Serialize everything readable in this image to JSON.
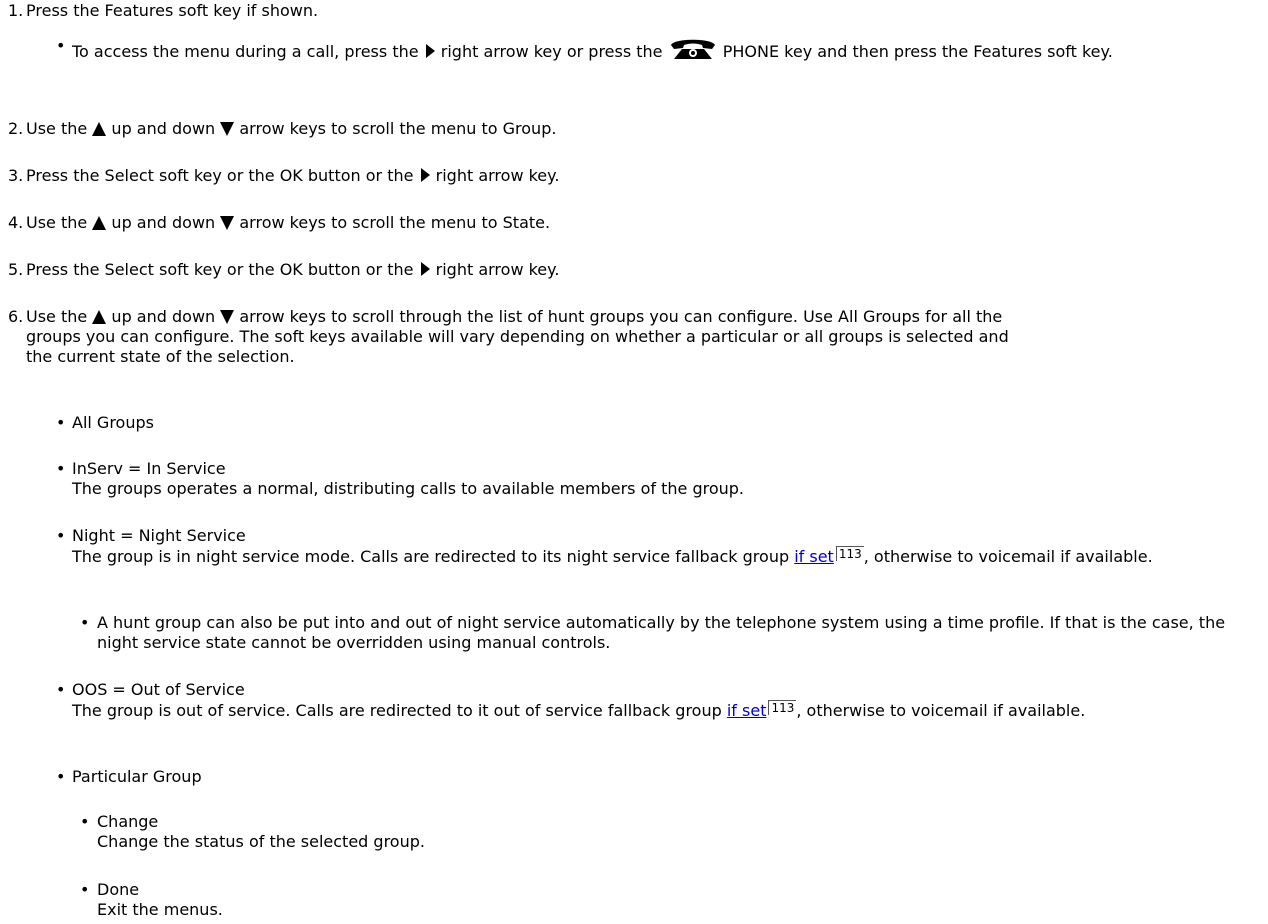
{
  "steps": [
    {
      "num": "1.",
      "pre": "Press the Features soft key if shown."
    },
    {
      "num": "2.",
      "pre": "Use the",
      "mid": "up and down",
      "post": "arrow keys to scroll the menu to Group."
    },
    {
      "num": "3.",
      "pre": "Press the Select soft key or the OK button or the",
      "post": "right arrow key."
    },
    {
      "num": "4.",
      "pre": "Use the",
      "mid": "up and down",
      "post": "arrow keys to scroll the menu to State."
    },
    {
      "num": "5.",
      "pre": "Press the Select soft key or the OK button or the",
      "post": "right arrow key."
    },
    {
      "num": "6.",
      "pre": "Use the",
      "mid": "up and down",
      "post": "arrow keys to scroll through the list of hunt groups you can configure. Use All Groups for all the groups you can configure. The soft keys available will vary depending on whether a particular or all groups is selected and the current state of the selection."
    }
  ],
  "step1_bullet": {
    "pre": "To access the menu during a call, press the",
    "mid": "right arrow key or press the",
    "post": "PHONE key and then press the Features soft key."
  },
  "groups": {
    "all_groups": "All Groups",
    "inserv_title": "InServ = In Service",
    "inserv_desc": "The groups operates a normal, distributing calls to available members of the group.",
    "night_title": "Night = Night Service",
    "night_desc_pre": "The group is in night service mode. Calls are redirected to its night service fallback group",
    "night_link": "if set",
    "night_pageref": "113",
    "night_desc_post": ", otherwise to voicemail if available.",
    "night_note": "A hunt group can also be put into and out of night service automatically by the telephone system using a time profile. If that is the case, the night service state cannot be overridden using manual controls.",
    "oos_title": "OOS = Out of Service",
    "oos_desc_pre": "The group is out of service. Calls are redirected to it out of service fallback group",
    "oos_link": "if set",
    "oos_pageref": "113",
    "oos_desc_post": ", otherwise to voicemail if available.",
    "particular": "Particular Group",
    "change_title": "Change",
    "change_desc": "Change the status of the selected group.",
    "done_title": "Done",
    "done_desc": "Exit the menus."
  },
  "bullet_char": "•",
  "icons": {
    "right": "right-arrow-icon",
    "up": "up-arrow-icon",
    "down": "down-arrow-icon",
    "phone": "phone-icon"
  }
}
